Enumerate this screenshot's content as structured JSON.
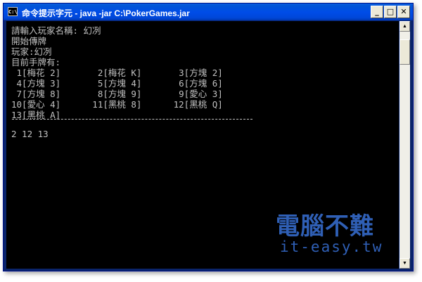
{
  "window": {
    "title": "命令提示字元 - java -jar C:\\PokerGames.jar",
    "app_icon_text": "C:\\",
    "buttons": {
      "minimize": "_",
      "maximize": "□",
      "close": "✕"
    }
  },
  "console": {
    "lines": [
      "請輸入玩家名稱: 幻冽",
      "開始傳牌",
      "玩家:幻冽",
      "目前手牌有:",
      " 1[梅花 2]       2[梅花 K]       3[方塊 2]",
      " 4[方塊 3]       5[方塊 4]       6[方塊 6]",
      " 7[方塊 8]       8[方塊 9]       9[愛心 3]",
      "10[愛心 4]      11[黑桃 8]      12[黑桃 Q]",
      "13[黑桃 A]"
    ],
    "input_line": "2 12 13"
  },
  "watermark": {
    "chinese": "電腦不難",
    "url": "it-easy.tw"
  },
  "colors": {
    "titlebar": "#0055e5",
    "console_bg": "#000000",
    "console_text": "#c0c0c0",
    "watermark": "#2f5fb5"
  }
}
